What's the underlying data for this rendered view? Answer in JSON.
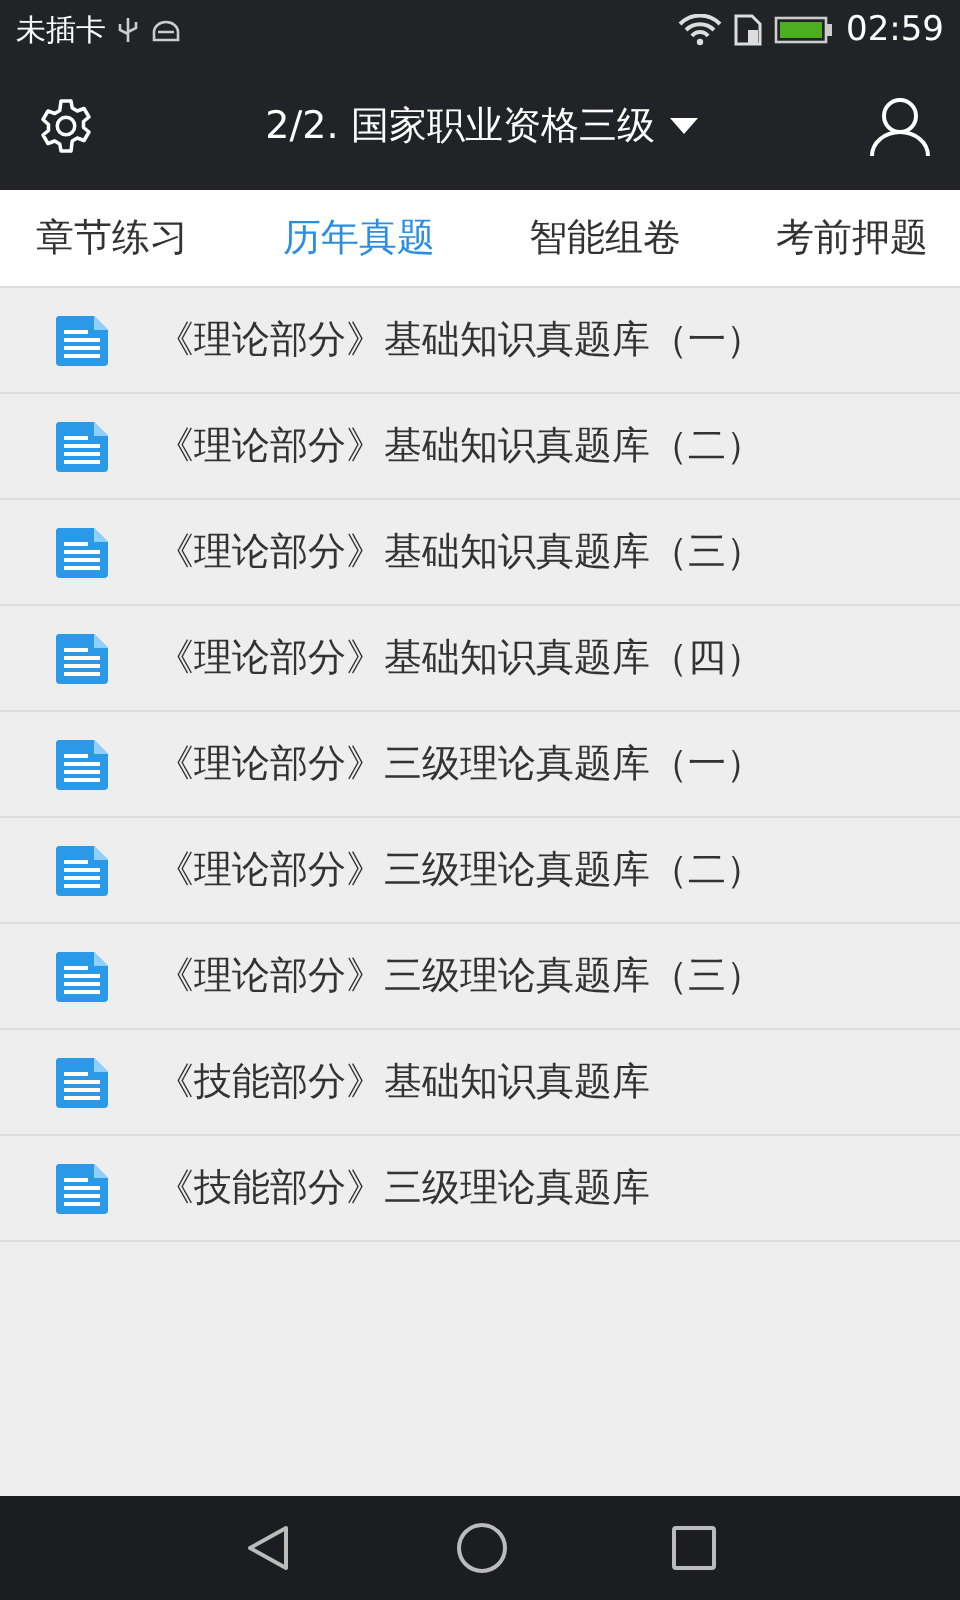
{
  "status_bar": {
    "carrier": "未插卡",
    "time": "02:59"
  },
  "app_bar": {
    "title": "2/2. 国家职业资格三级"
  },
  "tabs": [
    {
      "label": "章节练习",
      "selected": false
    },
    {
      "label": "历年真题",
      "selected": true
    },
    {
      "label": "智能组卷",
      "selected": false
    },
    {
      "label": "考前押题",
      "selected": false
    }
  ],
  "items": [
    {
      "title": "《理论部分》基础知识真题库（一）"
    },
    {
      "title": "《理论部分》基础知识真题库（二）"
    },
    {
      "title": "《理论部分》基础知识真题库（三）"
    },
    {
      "title": "《理论部分》基础知识真题库（四）"
    },
    {
      "title": "《理论部分》三级理论真题库（一）"
    },
    {
      "title": "《理论部分》三级理论真题库（二）"
    },
    {
      "title": "《理论部分》三级理论真题库（三）"
    },
    {
      "title": "《技能部分》基础知识真题库"
    },
    {
      "title": "《技能部分》三级理论真题库"
    }
  ]
}
